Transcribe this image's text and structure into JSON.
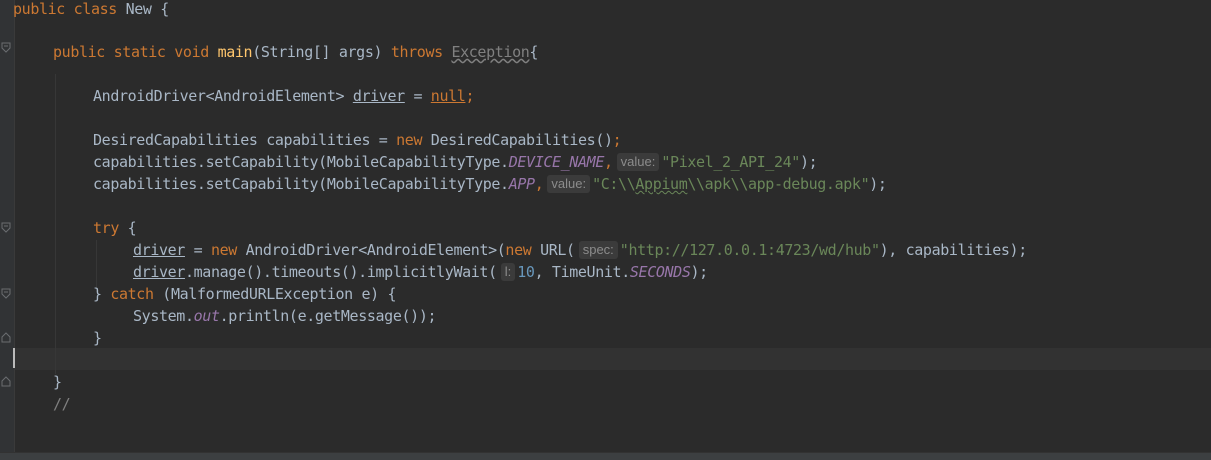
{
  "colors": {
    "background": "#2b2b2b",
    "keyword": "#cc7832",
    "function": "#ffc66d",
    "string": "#6a8759",
    "number": "#6897bb",
    "constant": "#9876aa",
    "comment": "#808080",
    "text": "#a9b7c6"
  },
  "code": {
    "l1": {
      "kw": "public class",
      "rest": " New {"
    },
    "l2": {
      "kw1": "public static void",
      "sp": " ",
      "fn": "main",
      "args": "(String[] args) ",
      "kw2": "throws",
      "sp2": " ",
      "exc": "Exception",
      "brace": "{"
    },
    "l3": {
      "type": "AndroidDriver<AndroidElement> ",
      "var": "driver",
      "eq": " = ",
      "nul": "null",
      "semi": ";"
    },
    "l4": {
      "a": "DesiredCapabilities capabilities = ",
      "kw": "new",
      "b": " DesiredCapabilities()",
      "semi": ";"
    },
    "l5": {
      "a": "capabilities.setCapability(MobileCapabilityType.",
      "const": "DEVICE_NAME",
      "comma": ",",
      "hint": "value:",
      "str": "\"Pixel_2_API_24\"",
      "end": ");"
    },
    "l6": {
      "a": "capabilities.setCapability(MobileCapabilityType.",
      "const": "APP",
      "comma": ",",
      "hint": "value:",
      "str1": "\"C:\\\\",
      "str2": "Appium",
      "str3": "\\\\apk\\\\app-debug.apk\"",
      "end": ");"
    },
    "l7": {
      "kw": "try",
      "rest": " {"
    },
    "l8": {
      "var": "driver",
      "eq": " = ",
      "kw1": "new",
      "a": " AndroidDriver<AndroidElement>(",
      "kw2": "new",
      "b": " URL(",
      "hint": "spec:",
      "str": "\"http://127.0.0.1:4723/wd/hub\"",
      "end": "), capabilities);"
    },
    "l9": {
      "var": "driver",
      "a": ".manage().timeouts().implicitlyWait(",
      "hint": "l:",
      "num": "10",
      "b": ", TimeUnit.",
      "const": "SECONDS",
      "end": ");"
    },
    "l10": {
      "a": "} ",
      "kw": "catch",
      "b": " (MalformedURLException e) {"
    },
    "l11": {
      "a": "System.",
      "const": "out",
      "b": ".println(e.getMessage());"
    },
    "l12": {
      "text": "}"
    },
    "l14": {
      "text": "}"
    },
    "l15": {
      "text": "//"
    }
  }
}
